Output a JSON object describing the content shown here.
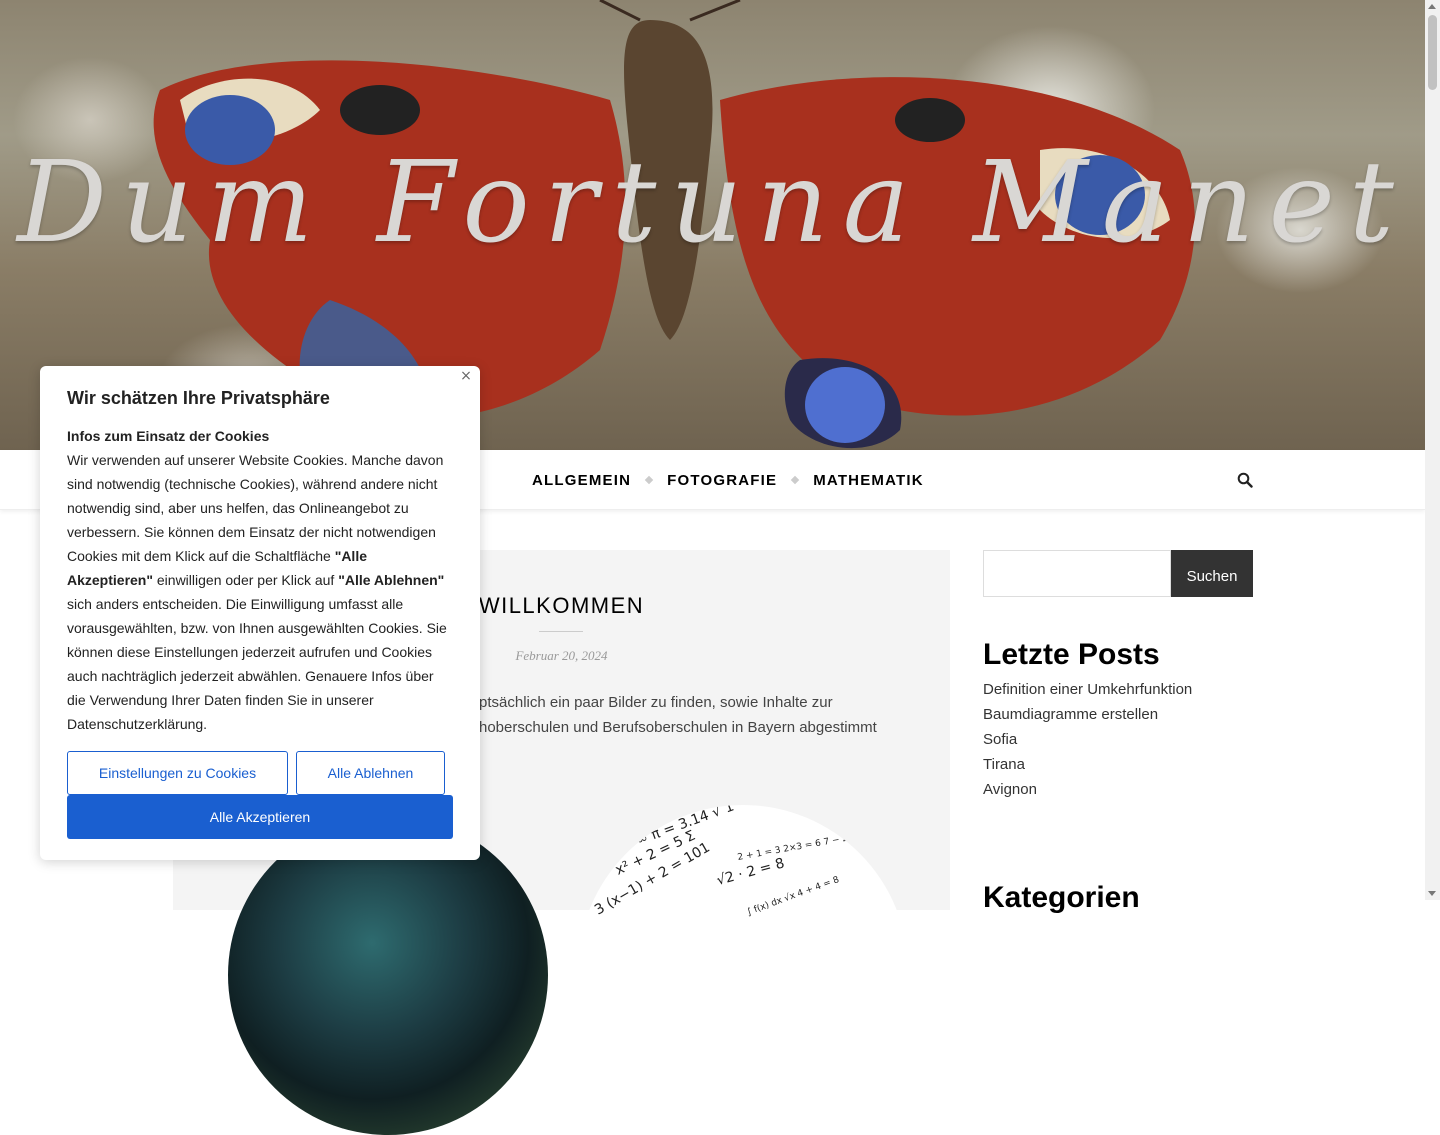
{
  "site": {
    "title": "Dum Fortuna Manet"
  },
  "nav": {
    "items": [
      {
        "label": "ALLGEMEIN"
      },
      {
        "label": "FOTOGRAFIE"
      },
      {
        "label": "MATHEMATIK"
      }
    ],
    "search_icon": "search-icon"
  },
  "post": {
    "title": "WILLKOMMEN",
    "date": "Februar 20, 2024",
    "excerpt_line1": "hauptsächlich ein paar Bilder zu finden, sowie Inhalte zur",
    "excerpt_line2": "hoberschulen und Berufsoberschulen in Bayern abgestimmt"
  },
  "sidebar": {
    "search_button": "Suchen",
    "recent_title": "Letzte Posts",
    "recent_posts": [
      "Definition einer Umkehrfunktion",
      "Baumdiagramme erstellen",
      "Sofia",
      "Tirana",
      "Avignon"
    ],
    "categories_title": "Kategorien"
  },
  "cookie": {
    "title": "Wir schätzen Ihre Privatsphäre",
    "subtitle": "Infos zum Einsatz der Cookies",
    "text_part1": "Wir verwenden auf unserer Website Cookies. Manche davon sind notwendig (technische Cookies), während andere nicht notwendig sind, aber uns helfen, das Onlineangebot zu verbessern. Sie können dem Einsatz der nicht notwendigen Cookies mit dem Klick auf die Schaltfläche ",
    "accept_quote": "\"Alle Akzeptieren\"",
    "text_part2": " einwilligen oder per Klick auf ",
    "reject_quote": "\"Alle Ablehnen\"",
    "text_part3": " sich anders entscheiden. Die Einwilligung umfasst alle vorausgewählten, bzw. von Ihnen ausgewählten Cookies. Sie können diese Einstellungen jederzeit aufrufen und Cookies auch nachträglich jederzeit abwählen. Genauere Infos über die Verwendung Ihrer Daten finden Sie in unserer Datenschutzerklärung.",
    "close_glyph": "×",
    "btn_settings": "Einstellungen zu Cookies",
    "btn_reject": "Alle Ablehnen",
    "btn_accept": "Alle Akzeptieren"
  },
  "colors": {
    "accent": "#1a5fd0",
    "dark_button": "#333333"
  }
}
